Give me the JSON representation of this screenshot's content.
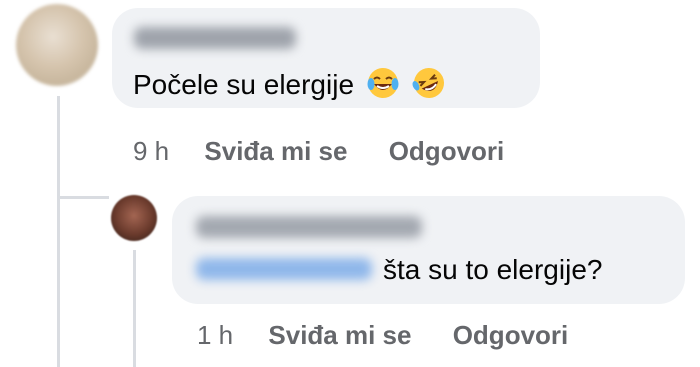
{
  "comments": [
    {
      "author": "",
      "text": "Počele su elergije",
      "emojis": [
        "tears-of-joy-emoji",
        "rolling-laughing-emoji"
      ],
      "time": "9 h",
      "like_label": "Sviđa mi se",
      "reply_label": "Odgovori"
    },
    {
      "author": "",
      "mention": "",
      "text": "šta su to elergije?",
      "time": "1 h",
      "like_label": "Sviđa mi se",
      "reply_label": "Odgovori"
    }
  ],
  "colors": {
    "bubble": "#f0f2f5",
    "text": "#050505",
    "meta": "#65676b",
    "thread_line": "#d9dce1"
  }
}
